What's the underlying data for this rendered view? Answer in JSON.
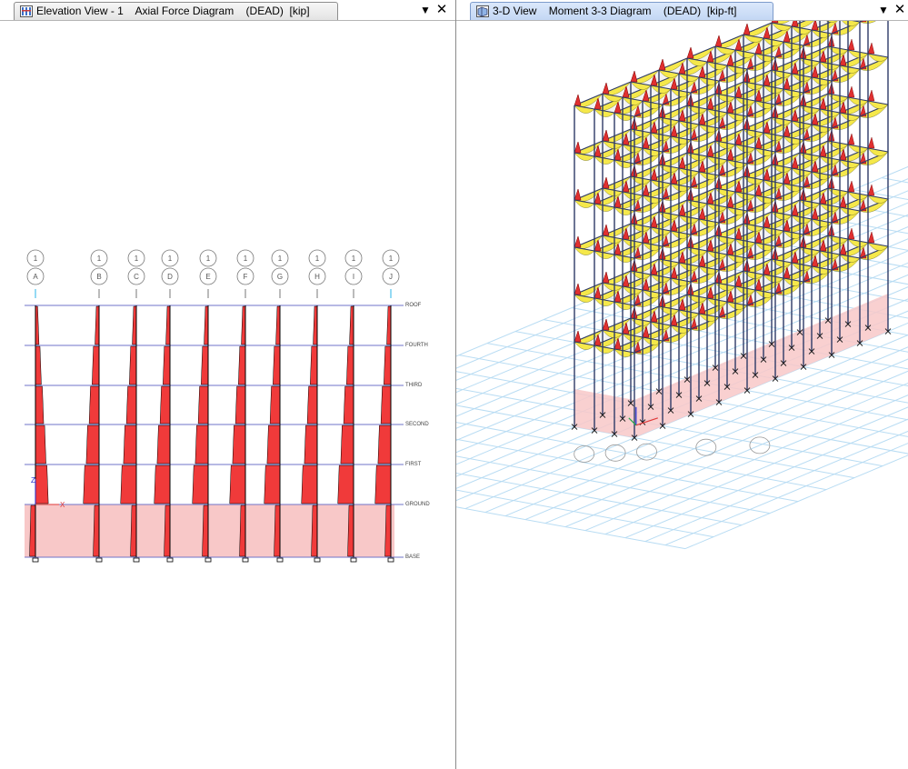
{
  "left_window": {
    "title": "Elevation View - 1    Axial Force Diagram    (DEAD)  [kip]",
    "dropdown_icon": "chevron-down-icon",
    "close_icon": "close-icon",
    "grid_top_label": "1",
    "grids": [
      "A",
      "B",
      "C",
      "D",
      "E",
      "F",
      "G",
      "H",
      "I",
      "J"
    ],
    "stories": [
      "ROOF",
      "FOURTH",
      "THIRD",
      "SECOND",
      "FIRST",
      "GROUND",
      "BASE"
    ],
    "axis_z": "Z",
    "axis_x": "X"
  },
  "right_window": {
    "title": "3-D View    Moment 3-3 Diagram    (DEAD)  [kip-ft]",
    "dropdown_icon": "chevron-down-icon",
    "close_icon": "close-icon"
  },
  "colors": {
    "frame_line": "#2d3a66",
    "axial_fill": "#f03a3a",
    "moment_fill": "#f5e84a",
    "moment_neg": "#e03030",
    "basement_fill": "#f8c8c8",
    "story_line": "#6f73c9",
    "grid_plane": "#b8dcf3",
    "slab_fill": "#dcdcdc"
  }
}
